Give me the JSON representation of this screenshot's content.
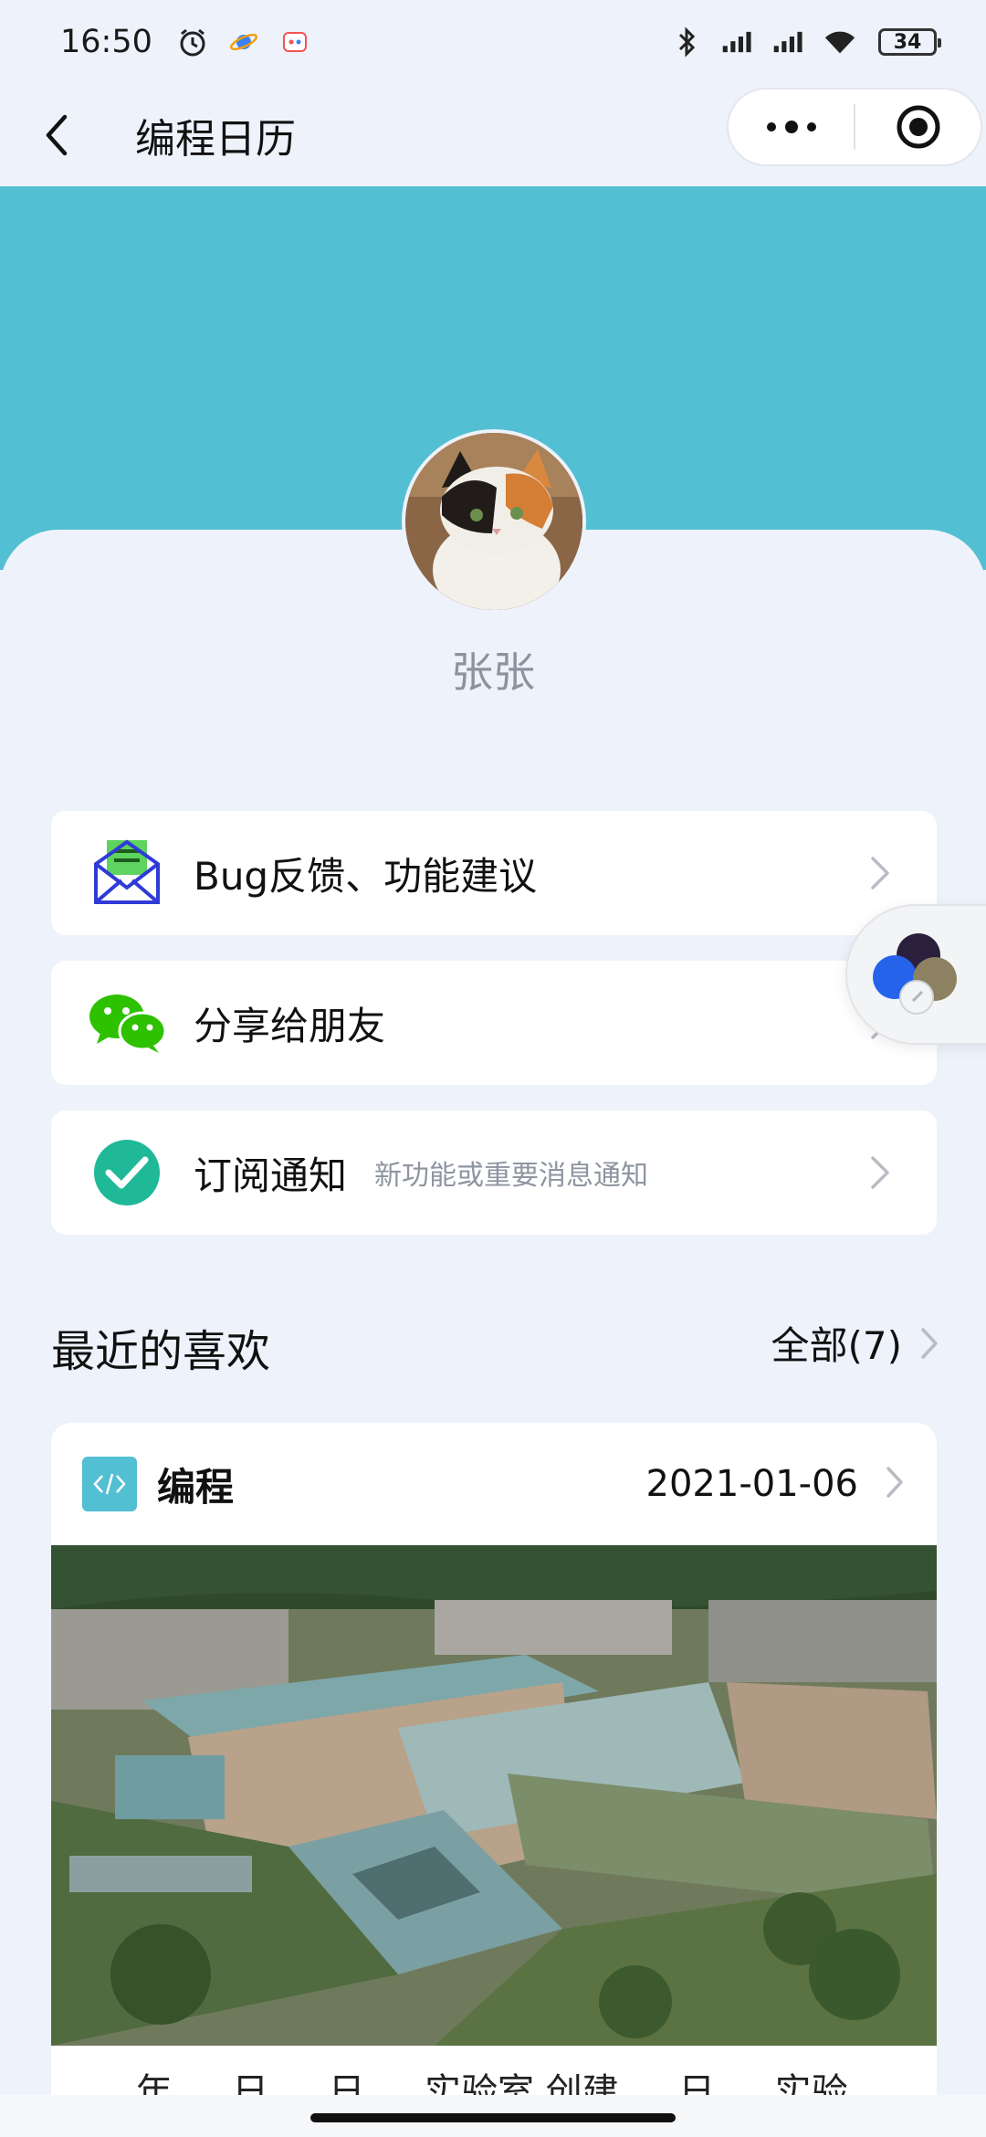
{
  "status_bar": {
    "time": "16:50",
    "battery": "34",
    "icons": [
      "alarm-icon",
      "planet-icon",
      "app-icon",
      "bluetooth-icon",
      "signal-icon",
      "signal-icon",
      "wifi-icon",
      "battery-icon"
    ]
  },
  "nav": {
    "title": "编程日历",
    "back_icon": "back-chevron-icon",
    "more_icon": "more-dots-icon",
    "close_icon": "target-icon"
  },
  "profile": {
    "name": "张张",
    "banner_color": "#52bfd2"
  },
  "menu": [
    {
      "label": "Bug反馈、功能建议",
      "sub": "",
      "icon": "mail-feedback-icon"
    },
    {
      "label": "分享给朋友",
      "sub": "",
      "icon": "wechat-icon"
    },
    {
      "label": "订阅通知",
      "sub": "新功能或重要消息通知",
      "icon": "check-circle-icon"
    }
  ],
  "recent": {
    "title": "最近的喜欢",
    "more_label": "全部(7)",
    "card": {
      "category": "编程",
      "date": "2021-01-06",
      "icon": "code-icon",
      "caption": "… 年 … 日 … 日 … 实验室 创建 … 日 … 实验 …"
    }
  },
  "colors": {
    "accent": "#52bfd2",
    "background": "#eef2fb",
    "wechat_green": "#2dc100",
    "check_teal": "#1fb997"
  }
}
